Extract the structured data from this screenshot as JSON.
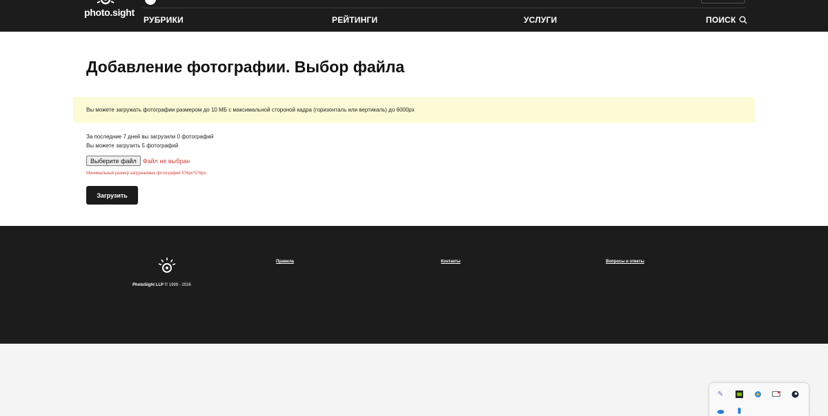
{
  "header": {
    "logo_text": "photo.sight",
    "nav": {
      "rubrics": "РУБРИКИ",
      "ratings": "РЕЙТИНГИ",
      "services": "УСЛУГИ",
      "search": "ПОИСК"
    }
  },
  "main": {
    "title": "Добавление фотографии. Выбор файла",
    "notice": "Вы можете загружать фотографии размером до 10 МБ с максимальной стороной кадра (горизонталь или вертикаль) до 6000px",
    "uploads_info": "За последние 7 дней вы загрузили 0 фотографий",
    "remaining_info": "Вы можете загрузить 5 фотографий",
    "file_button": "Выберите файл",
    "file_status": "Файл не выбран",
    "min_size": "Минимальный размер загружаемых фотографий 576px*576px.",
    "upload_button": "Загрузить"
  },
  "footer": {
    "company": "PhotoSight LLP",
    "years": "© 1999 - 2026",
    "links": {
      "rules": "Правила",
      "contacts": "Контакты",
      "faq": "Вопросы и ответы"
    }
  },
  "colors": {
    "header_bg": "#1c1c1c",
    "notice_bg": "#fdfbd6",
    "error_red": "#d1413b"
  },
  "tray_icons": [
    "pen-icon",
    "nvidia-icon",
    "globe-icon",
    "display-icon",
    "steam-icon",
    "cloud-icon",
    "dropbox-icon"
  ]
}
